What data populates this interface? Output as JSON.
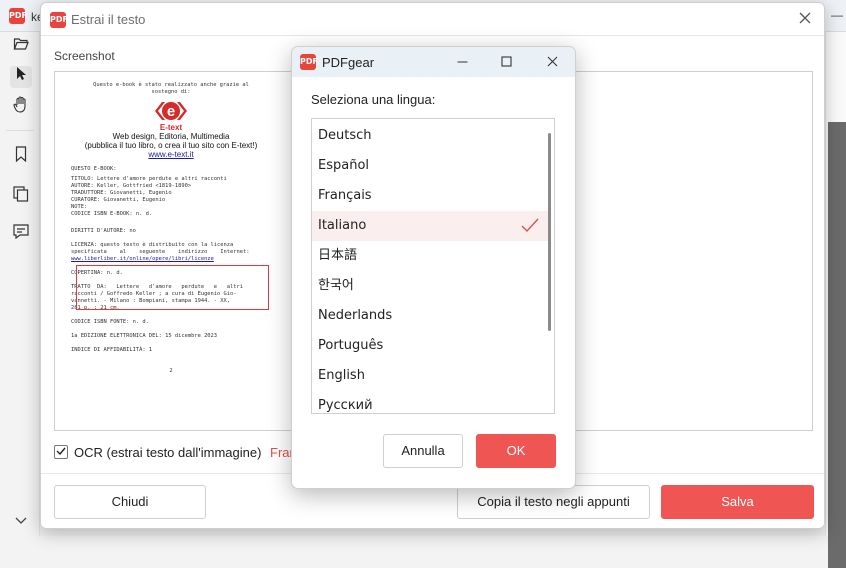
{
  "app": {
    "tab_title": "ke",
    "logo_text": "PDF",
    "left_toolbar_icons": [
      "folder-open-icon",
      "pointer-icon",
      "hand-icon",
      "bookmark-icon",
      "copy-pages-icon",
      "comment-icon",
      "chevron-down-icon"
    ]
  },
  "extract_dialog": {
    "title": "Estrai il testo",
    "section_label": "Screenshot",
    "ocr_checked": true,
    "ocr_label": "OCR (estrai testo dall'immagine)",
    "ocr_language": "Français",
    "buttons": {
      "close": "Chiudi",
      "copy": "Copia il testo negli appunti",
      "save": "Salva"
    },
    "preview": {
      "intro_line1": "Questo e-book è stato realizzato anche grazie al",
      "intro_line2": "sostegno di:",
      "brand": "E-text",
      "tagline1": "Web design, Editoria, Multimedia",
      "tagline2": "(pubblica il tuo libro, o crea il tuo sito con E-text!)",
      "website": "www.e-text.it",
      "lines": [
        "QUESTO E-BOOK:",
        "",
        "TITOLO: Lettere d'amore perdute e altri racconti",
        "AUTORE: Keller, Gottfried <1819-1890>",
        "TRADUTTORE: Giovanetti, Eugenio",
        "CURATORE: Giovanetti, Eugenio",
        "NOTE:",
        "CODICE ISBN E-BOOK: n. d.",
        "",
        "DIRITTI D'AUTORE: no",
        "",
        "LICENZA: questo testo è distribuito con la licenza",
        "specificata    al    seguente    indirizzo    Internet:",
        "www.liberliber.it/online/opere/libri/licenze",
        "",
        "COPERTINA: n. d.",
        "",
        "TRATTO  DA:   Lettere   d'amore   perdute   e   altri",
        "racconti / Goffredo Keller ; a cura di Eugenio Gio-",
        "vannetti. - Milano : Bompiani, stampa 1944. - XX,",
        "281 p. ; 21 cm.",
        "",
        "CODICE ISBN FONTE: n. d.",
        "",
        "1a EDIZIONE ELETTRONICA DEL: 15 dicembre 2023",
        "",
        "INDICE DI AFFIDABILITÀ: 1"
      ],
      "page_number": "2"
    }
  },
  "language_dialog": {
    "title": "PDFgear",
    "logo_text": "PDF",
    "prompt": "Seleziona una lingua:",
    "languages": [
      "Deutsch",
      "Español",
      "Français",
      "Italiano",
      "日本語",
      "한국어",
      "Nederlands",
      "Português",
      "English",
      "Русский"
    ],
    "selected": "Italiano",
    "buttons": {
      "cancel": "Annulla",
      "ok": "OK"
    }
  }
}
